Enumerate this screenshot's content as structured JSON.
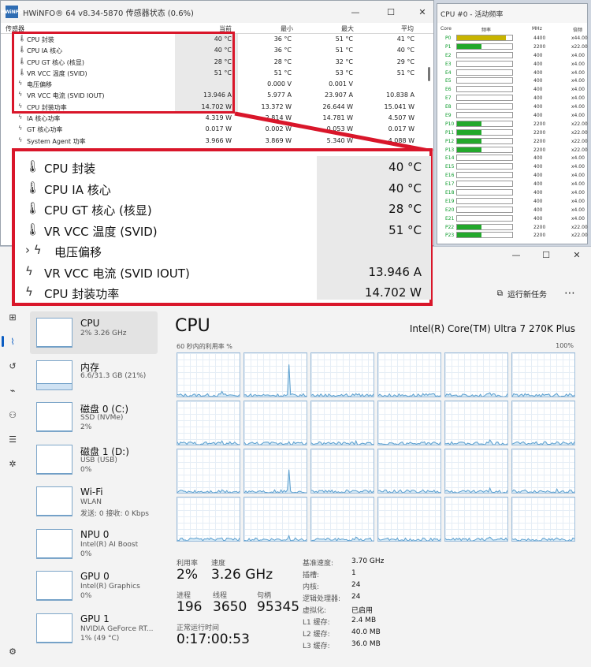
{
  "hwinfo": {
    "title": "HWiNFO® 64 v8.34-5870 传感器状态 (0.6%)",
    "logo": "HWiNFO",
    "columns": [
      "传感器",
      "当前",
      "最小",
      "最大",
      "平均"
    ],
    "rows": [
      {
        "icon": "thermometer-icon",
        "name": "CPU 封装",
        "cur": "40 °C",
        "min": "36 °C",
        "max": "51 °C",
        "avg": "41 °C"
      },
      {
        "icon": "thermometer-icon",
        "name": "CPU IA 核心",
        "cur": "40 °C",
        "min": "36 °C",
        "max": "51 °C",
        "avg": "40 °C"
      },
      {
        "icon": "thermometer-icon",
        "name": "CPU GT 核心 (核显)",
        "cur": "28 °C",
        "min": "28 °C",
        "max": "32 °C",
        "avg": "29 °C"
      },
      {
        "icon": "thermometer-icon",
        "name": "VR VCC 温度 (SVID)",
        "cur": "51 °C",
        "min": "51 °C",
        "max": "53 °C",
        "avg": "51 °C"
      },
      {
        "icon": "lightning-icon",
        "name": "电压偏移",
        "cur": "",
        "min": "0.000 V",
        "max": "0.001 V",
        "avg": ""
      },
      {
        "icon": "lightning-icon",
        "name": "VR VCC 电流 (SVID IOUT)",
        "cur": "13.946 A",
        "min": "5.977 A",
        "max": "23.907 A",
        "avg": "10.838 A"
      },
      {
        "icon": "lightning-icon",
        "name": "CPU 封装功率",
        "cur": "14.702 W",
        "min": "13.372 W",
        "max": "26.644 W",
        "avg": "15.041 W"
      },
      {
        "icon": "lightning-icon",
        "name": "IA 核心功率",
        "cur": "4.319 W",
        "min": "2.814 W",
        "max": "14.781 W",
        "avg": "4.507 W"
      },
      {
        "icon": "lightning-icon",
        "name": "GT 核心功率",
        "cur": "0.017 W",
        "min": "0.002 W",
        "max": "0.053 W",
        "avg": "0.017 W"
      },
      {
        "icon": "lightning-icon",
        "name": "System Agent 功率",
        "cur": "3.966 W",
        "min": "3.869 W",
        "max": "5.340 W",
        "avg": "4.088 W"
      }
    ]
  },
  "activity": {
    "title": "CPU #0 - 活动频率",
    "columns": [
      "Core",
      "频率",
      "MHz",
      "倍频"
    ],
    "rows": [
      {
        "core": "P0",
        "fill": 0.88,
        "mhz": "4400",
        "mul": "x44.00",
        "color": "#c8b400"
      },
      {
        "core": "P1",
        "fill": 0.44,
        "mhz": "2200",
        "mul": "x22.00",
        "color": "#23a82c"
      },
      {
        "core": "E2",
        "fill": 0.0,
        "mhz": "400",
        "mul": "x4.00",
        "color": "#23a82c"
      },
      {
        "core": "E3",
        "fill": 0.0,
        "mhz": "400",
        "mul": "x4.00",
        "color": "#23a82c"
      },
      {
        "core": "E4",
        "fill": 0.0,
        "mhz": "400",
        "mul": "x4.00",
        "color": "#23a82c"
      },
      {
        "core": "E5",
        "fill": 0.0,
        "mhz": "400",
        "mul": "x4.00",
        "color": "#23a82c"
      },
      {
        "core": "E6",
        "fill": 0.0,
        "mhz": "400",
        "mul": "x4.00",
        "color": "#23a82c"
      },
      {
        "core": "E7",
        "fill": 0.0,
        "mhz": "400",
        "mul": "x4.00",
        "color": "#23a82c"
      },
      {
        "core": "E8",
        "fill": 0.0,
        "mhz": "400",
        "mul": "x4.00",
        "color": "#23a82c"
      },
      {
        "core": "E9",
        "fill": 0.0,
        "mhz": "400",
        "mul": "x4.00",
        "color": "#23a82c"
      },
      {
        "core": "P10",
        "fill": 0.44,
        "mhz": "2200",
        "mul": "x22.00",
        "color": "#23a82c"
      },
      {
        "core": "P11",
        "fill": 0.44,
        "mhz": "2200",
        "mul": "x22.00",
        "color": "#23a82c"
      },
      {
        "core": "P12",
        "fill": 0.44,
        "mhz": "2200",
        "mul": "x22.00",
        "color": "#23a82c"
      },
      {
        "core": "P13",
        "fill": 0.44,
        "mhz": "2200",
        "mul": "x22.00",
        "color": "#23a82c"
      },
      {
        "core": "E14",
        "fill": 0.0,
        "mhz": "400",
        "mul": "x4.00",
        "color": "#23a82c"
      },
      {
        "core": "E15",
        "fill": 0.0,
        "mhz": "400",
        "mul": "x4.00",
        "color": "#23a82c"
      },
      {
        "core": "E16",
        "fill": 0.0,
        "mhz": "400",
        "mul": "x4.00",
        "color": "#23a82c"
      },
      {
        "core": "E17",
        "fill": 0.0,
        "mhz": "400",
        "mul": "x4.00",
        "color": "#23a82c"
      },
      {
        "core": "E18",
        "fill": 0.0,
        "mhz": "400",
        "mul": "x4.00",
        "color": "#23a82c"
      },
      {
        "core": "E19",
        "fill": 0.0,
        "mhz": "400",
        "mul": "x4.00",
        "color": "#23a82c"
      },
      {
        "core": "E20",
        "fill": 0.0,
        "mhz": "400",
        "mul": "x4.00",
        "color": "#23a82c"
      },
      {
        "core": "E21",
        "fill": 0.0,
        "mhz": "400",
        "mul": "x4.00",
        "color": "#23a82c"
      },
      {
        "core": "P22",
        "fill": 0.44,
        "mhz": "2200",
        "mul": "x22.00",
        "color": "#23a82c"
      },
      {
        "core": "P23",
        "fill": 0.44,
        "mhz": "2200",
        "mul": "x22.00",
        "color": "#23a82c"
      }
    ]
  },
  "taskmgr": {
    "toolbar": {
      "new_task_label": "运行新任务",
      "more_label": "⋯"
    },
    "perf_items": [
      {
        "name": "CPU",
        "sub1": "2%  3.26 GHz",
        "sub2": "",
        "fill": 0.02,
        "selected": true
      },
      {
        "name": "内存",
        "sub1": "6.6/31.3 GB (21%)",
        "sub2": "",
        "fill": 0.21,
        "selected": false
      },
      {
        "name": "磁盘 0 (C:)",
        "sub1": "SSD (NVMe)",
        "sub2": "2%",
        "fill": 0.02,
        "selected": false
      },
      {
        "name": "磁盘 1 (D:)",
        "sub1": "USB (USB)",
        "sub2": "0%",
        "fill": 0.0,
        "selected": false
      },
      {
        "name": "Wi-Fi",
        "sub1": "WLAN",
        "sub2": "发送: 0 接收: 0 Kbps",
        "fill": 0.0,
        "selected": false
      },
      {
        "name": "NPU 0",
        "sub1": "Intel(R) AI Boost",
        "sub2": "0%",
        "fill": 0.0,
        "selected": false
      },
      {
        "name": "GPU 0",
        "sub1": "Intel(R) Graphics",
        "sub2": "0%",
        "fill": 0.0,
        "selected": false
      },
      {
        "name": "GPU 1",
        "sub1": "NVIDIA GeForce RT...",
        "sub2": "1% (49 °C)",
        "fill": 0.01,
        "selected": false
      }
    ],
    "cpu_header": "CPU",
    "cpu_model": "Intel(R) Core(TM) Ultra 7 270K Plus",
    "util_label": "60 秒内的利用率 %",
    "util_max": "100%",
    "core_peaks": [
      0.15,
      0.75,
      0.1,
      0.1,
      0.12,
      0.1,
      0.12,
      0.1,
      0.12,
      0.08,
      0.14,
      0.1,
      0.1,
      0.55,
      0.08,
      0.1,
      0.14,
      0.12,
      0.1,
      0.15,
      0.12,
      0.1,
      0.12,
      0.1
    ],
    "stats": {
      "util_label": "利用率",
      "util_value": "2%",
      "speed_label": "速度",
      "speed_value": "3.26 GHz",
      "proc_label": "进程",
      "proc_value": "196",
      "thread_label": "线程",
      "thread_value": "3650",
      "handle_label": "句柄",
      "handle_value": "95345",
      "uptime_label": "正常运行时间",
      "uptime_value": "0:17:00:53"
    },
    "specs": [
      {
        "k": "基准速度:",
        "v": "3.70 GHz"
      },
      {
        "k": "插槽:",
        "v": "1"
      },
      {
        "k": "内核:",
        "v": "24"
      },
      {
        "k": "逻辑处理器:",
        "v": "24"
      },
      {
        "k": "虚拟化:",
        "v": "已启用"
      },
      {
        "k": "L1 缓存:",
        "v": "2.4 MB"
      },
      {
        "k": "L2 缓存:",
        "v": "40.0 MB"
      },
      {
        "k": "L3 缓存:",
        "v": "36.0 MB"
      }
    ]
  },
  "colors": {
    "highlight": "#d9162a",
    "accent": "#0a5cc2",
    "graph_line": "#5b9fcf",
    "graph_fill": "#cfe6f4"
  }
}
